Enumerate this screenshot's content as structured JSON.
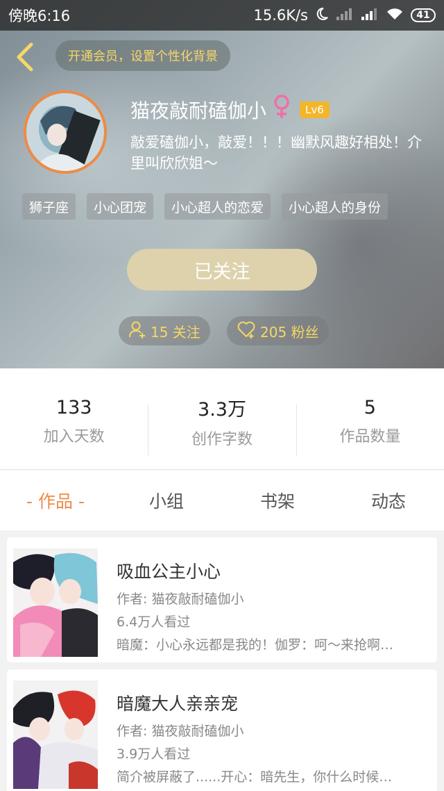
{
  "status_bar": {
    "time": "傍晚6:16",
    "speed": "15.6K/s",
    "battery": "41"
  },
  "header": {
    "vip_prompt": "开通会员，设置个性化背景",
    "username": "猫夜敲耐磕伽小",
    "gender_symbol": "♀",
    "level": "Lv6",
    "bio": "敲爱磕伽小，敲爱！！！幽默风趣好相处！介里叫欣欣姐～",
    "tags": [
      "狮子座",
      "小心团宠",
      "小心超人的恋爱",
      "小心超人的身份"
    ],
    "follow_button": "已关注",
    "following": "15 关注",
    "fans": "205 粉丝",
    "accent_color": "#f6d768"
  },
  "stats": [
    {
      "value": "133",
      "label": "加入天数"
    },
    {
      "value": "3.3万",
      "label": "创作字数"
    },
    {
      "value": "5",
      "label": "作品数量"
    }
  ],
  "tabs": [
    {
      "label": "- 作品 -",
      "active": true
    },
    {
      "label": "小组",
      "active": false
    },
    {
      "label": "书架",
      "active": false
    },
    {
      "label": "动态",
      "active": false
    }
  ],
  "works": [
    {
      "title": "吸血公主小心",
      "author": "作者: 猫夜敲耐磕伽小",
      "views": "6.4万人看过",
      "desc": "暗魔：小心永远都是我的！伽罗：呵～来抢啊…"
    },
    {
      "title": "暗魔大人亲亲宠",
      "author": "作者: 猫夜敲耐磕伽小",
      "views": "3.9万人看过",
      "desc": "简介被屏蔽了......开心：暗先生，你什么时候…"
    }
  ]
}
